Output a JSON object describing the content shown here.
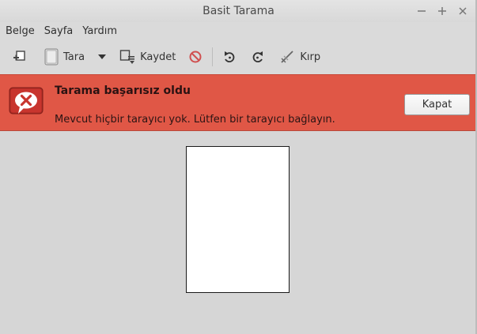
{
  "window": {
    "title": "Basit Tarama"
  },
  "menubar": {
    "items": [
      "Belge",
      "Sayfa",
      "Yardım"
    ]
  },
  "toolbar": {
    "new_icon": "new-document-icon",
    "scan_label": "Tara",
    "save_label": "Kaydet",
    "crop_label": "Kırp",
    "icons": [
      "new-document-icon",
      "scanner-icon",
      "chevron-down-icon",
      "save-icon",
      "stop-icon",
      "rotate-left-icon",
      "rotate-right-icon",
      "crop-icon"
    ]
  },
  "error": {
    "title": "Tarama başarısız oldu",
    "message": "Mevcut hiçbir tarayıcı yok. Lütfen bir tarayıcı bağlayın.",
    "close_label": "Kapat",
    "icon": "error-speech-bubble-icon",
    "color": "#e05746"
  },
  "colors": {
    "error_bar": "#e05746",
    "background": "#d6d6d6"
  }
}
